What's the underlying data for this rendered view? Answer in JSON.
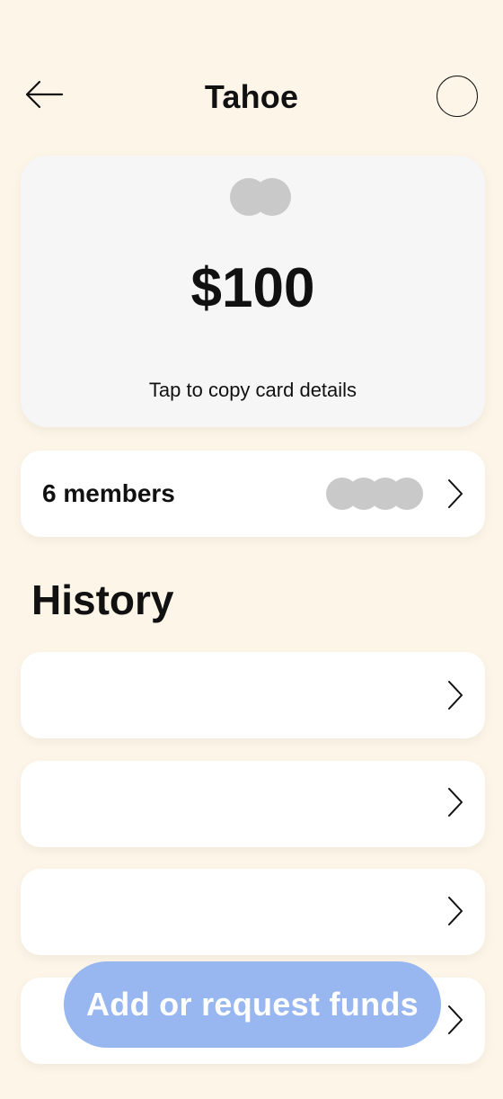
{
  "header": {
    "title": "Tahoe",
    "back_icon": "arrow-left-icon",
    "profile_icon": "circle-icon"
  },
  "card": {
    "logo_icon": "card-network-logo-icon",
    "balance": "$100",
    "caption": "Tap to copy card details",
    "background_color": "#f6f6f6"
  },
  "members": {
    "label": "6 members",
    "avatar_count_shown": 4,
    "chevron_icon": "chevron-right-icon"
  },
  "history": {
    "heading": "History",
    "items": [
      {
        "label": ""
      },
      {
        "label": ""
      },
      {
        "label": ""
      },
      {
        "label": ""
      }
    ]
  },
  "cta": {
    "label": "Add or request funds",
    "color": "#98b6ef"
  },
  "colors": {
    "page_background": "#fdf6e8",
    "placeholder_gray": "#c9c9c9",
    "text": "#111111"
  }
}
